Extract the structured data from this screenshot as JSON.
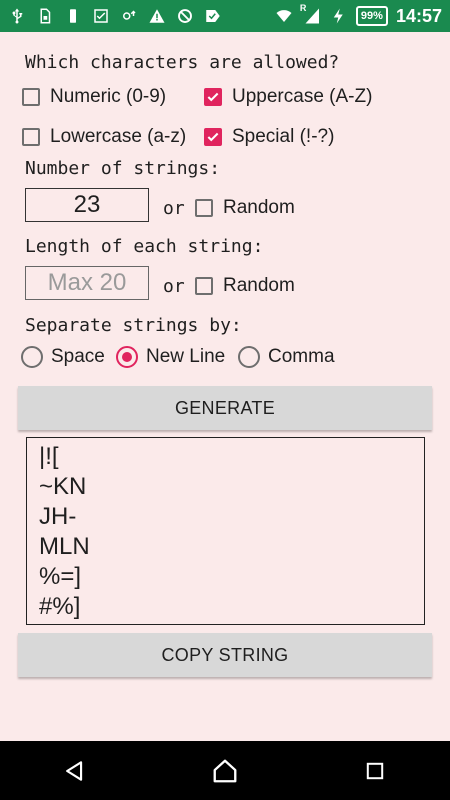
{
  "status_bar": {
    "time": "14:57",
    "battery": "99%",
    "icons_left": [
      "usb-icon",
      "file-icon",
      "sim-icon",
      "checkbox-icon",
      "settings-icon",
      "warning-icon",
      "blocked-icon",
      "check-icon"
    ],
    "icons_right": [
      "wifi-icon",
      "signal-icon",
      "charging-icon"
    ],
    "roaming_mark": "R",
    "color": "#1a8a4f"
  },
  "chars": {
    "heading": "Which characters are allowed?",
    "options": [
      {
        "label": "Numeric (0-9)",
        "checked": false
      },
      {
        "label": "Uppercase (A-Z)",
        "checked": true
      },
      {
        "label": "Lowercase (a-z)",
        "checked": false
      },
      {
        "label": "Special (!-?)",
        "checked": true
      }
    ]
  },
  "count": {
    "heading": "Number of strings:",
    "value": "23",
    "or": "or",
    "random_label": "Random",
    "random_checked": false
  },
  "length": {
    "heading": "Length of each string:",
    "placeholder": "Max 20",
    "or": "or",
    "random_label": "Random",
    "random_checked": false
  },
  "separator": {
    "heading": "Separate strings by:",
    "options": [
      {
        "label": "Space",
        "selected": false
      },
      {
        "label": "New Line",
        "selected": true
      },
      {
        "label": "Comma",
        "selected": false
      }
    ]
  },
  "generate_label": "GENERATE",
  "output_lines": [
    "|![",
    "~KN",
    "JH-",
    "MLN",
    "%=]",
    "#%]"
  ],
  "copy_label": "COPY STRING",
  "accent": "#e0245e"
}
